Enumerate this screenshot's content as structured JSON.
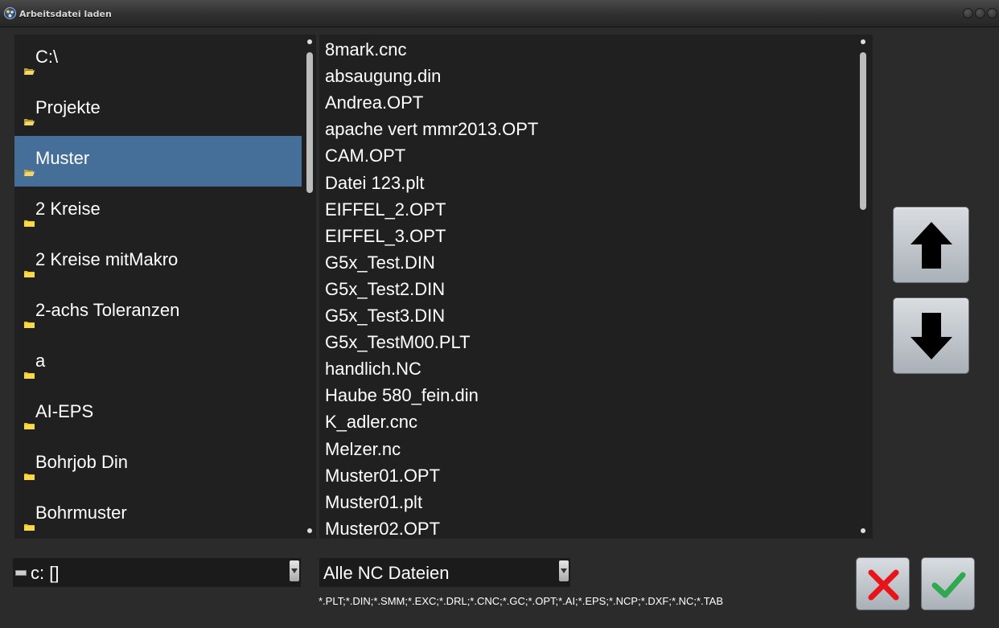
{
  "window": {
    "title": "Arbeitsdatei laden"
  },
  "directories": {
    "selected_index": 2,
    "items": [
      {
        "label": "C:\\",
        "state": "open"
      },
      {
        "label": "Projekte",
        "state": "open"
      },
      {
        "label": "Muster",
        "state": "open"
      },
      {
        "label": "2 Kreise",
        "state": "closed"
      },
      {
        "label": "2 Kreise mitMakro",
        "state": "closed"
      },
      {
        "label": "2-achs Toleranzen",
        "state": "closed"
      },
      {
        "label": "a",
        "state": "closed"
      },
      {
        "label": "AI-EPS",
        "state": "closed"
      },
      {
        "label": "Bohrjob Din",
        "state": "closed"
      },
      {
        "label": "Bohrmuster",
        "state": "closed"
      }
    ]
  },
  "files": {
    "items": [
      "8mark.cnc",
      "absaugung.din",
      "Andrea.OPT",
      "apache vert mmr2013.OPT",
      "CAM.OPT",
      "Datei 123.plt",
      "EIFFEL_2.OPT",
      "EIFFEL_3.OPT",
      "G5x_Test.DIN",
      "G5x_Test2.DIN",
      "G5x_Test3.DIN",
      "G5x_TestM00.PLT",
      "handlich.NC",
      "Haube 580_fein.din",
      "K_adler.cnc",
      "Melzer.nc",
      "Muster01.OPT",
      "Muster01.plt",
      "Muster02.OPT"
    ]
  },
  "drive_select": {
    "value": "c: []",
    "icon": "drive-icon"
  },
  "filter_select": {
    "value": "Alle NC Dateien",
    "description": "*.PLT;*.DIN;*.SMM;*.EXC;*.DRL;*.CNC;*.GC;*.OPT;*.AI;*.EPS;*.NCP;*.DXF;*.NC;*.TAB"
  },
  "buttons": {
    "scroll_up": "arrow-up-icon",
    "scroll_down": "arrow-down-icon",
    "cancel": "cross-icon",
    "confirm": "checkmark-icon"
  },
  "colors": {
    "selection": "#456f99",
    "cancel": "#e8141a",
    "confirm": "#2fa84f"
  }
}
